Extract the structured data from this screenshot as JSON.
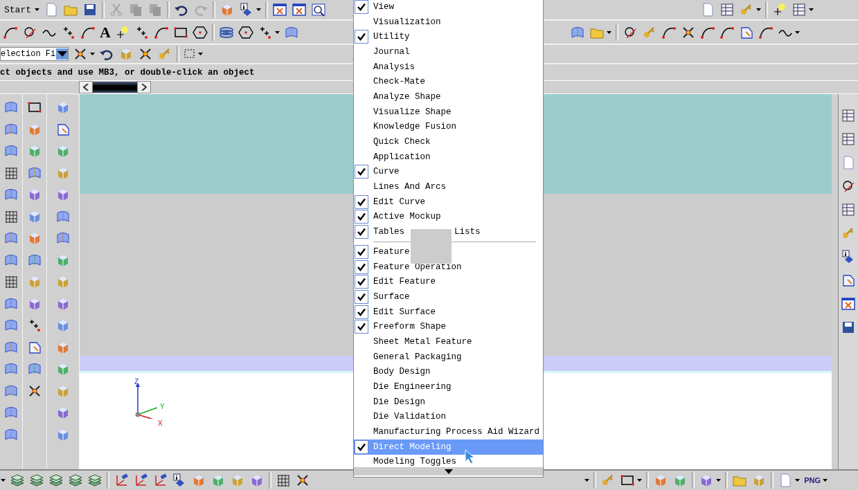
{
  "toolbar": {
    "start_label": "Start",
    "text_tool_label": "A"
  },
  "selection_filter": {
    "value": "election Fi"
  },
  "cue_line": "ct objects and use MB3, or double-click an object",
  "axes": {
    "z": "Z",
    "y": "Y",
    "x": "X"
  },
  "bottom_toolbar": {
    "png_label": "PNG"
  },
  "menu": {
    "items": [
      {
        "kind": "item",
        "label": "View",
        "checked": true,
        "selected": false
      },
      {
        "kind": "item",
        "label": "Visualization",
        "checked": false,
        "selected": false
      },
      {
        "kind": "item",
        "label": "Utility",
        "checked": true,
        "selected": false
      },
      {
        "kind": "item",
        "label": "Journal",
        "checked": false,
        "selected": false
      },
      {
        "kind": "item",
        "label": "Analysis",
        "checked": false,
        "selected": false
      },
      {
        "kind": "item",
        "label": "Check-Mate",
        "checked": false,
        "selected": false
      },
      {
        "kind": "item",
        "label": "Analyze Shape",
        "checked": false,
        "selected": false
      },
      {
        "kind": "item",
        "label": "Visualize Shape",
        "checked": false,
        "selected": false
      },
      {
        "kind": "item",
        "label": "Knowledge Fusion",
        "checked": false,
        "selected": false
      },
      {
        "kind": "item",
        "label": "Quick Check",
        "checked": false,
        "selected": false
      },
      {
        "kind": "item",
        "label": "Application",
        "checked": false,
        "selected": false
      },
      {
        "kind": "item",
        "label": "Curve",
        "checked": true,
        "selected": false
      },
      {
        "kind": "item",
        "label": "Lines And Arcs",
        "checked": false,
        "selected": false
      },
      {
        "kind": "item",
        "label": "Edit Curve",
        "checked": true,
        "selected": false
      },
      {
        "kind": "item",
        "label": "Active Mockup",
        "checked": true,
        "selected": false
      },
      {
        "kind": "item",
        "label": "Tables",
        "label_after": "Lists",
        "checked": true,
        "selected": false
      },
      {
        "kind": "separator"
      },
      {
        "kind": "item",
        "label": "Feature",
        "checked": true,
        "selected": false
      },
      {
        "kind": "item",
        "label": "Feature Operation",
        "checked": true,
        "selected": false
      },
      {
        "kind": "item",
        "label": "Edit Feature",
        "checked": true,
        "selected": false
      },
      {
        "kind": "item",
        "label": "Surface",
        "checked": true,
        "selected": false
      },
      {
        "kind": "item",
        "label": "Edit Surface",
        "checked": true,
        "selected": false
      },
      {
        "kind": "item",
        "label": "Freeform Shape",
        "checked": true,
        "selected": false
      },
      {
        "kind": "item",
        "label": "Sheet Metal Feature",
        "checked": false,
        "selected": false
      },
      {
        "kind": "item",
        "label": "General Packaging",
        "checked": false,
        "selected": false
      },
      {
        "kind": "item",
        "label": "Body Design",
        "checked": false,
        "selected": false
      },
      {
        "kind": "item",
        "label": "Die Engineering",
        "checked": false,
        "selected": false
      },
      {
        "kind": "item",
        "label": "Die Design",
        "checked": false,
        "selected": false
      },
      {
        "kind": "item",
        "label": "Die Validation",
        "checked": false,
        "selected": false
      },
      {
        "kind": "item",
        "label": "Manufacturing Process Aid Wizard",
        "checked": false,
        "selected": false
      },
      {
        "kind": "item",
        "label": "Direct Modeling",
        "checked": true,
        "selected": true
      },
      {
        "kind": "item",
        "label": "Modeling Toggles",
        "checked": false,
        "selected": false
      }
    ]
  }
}
